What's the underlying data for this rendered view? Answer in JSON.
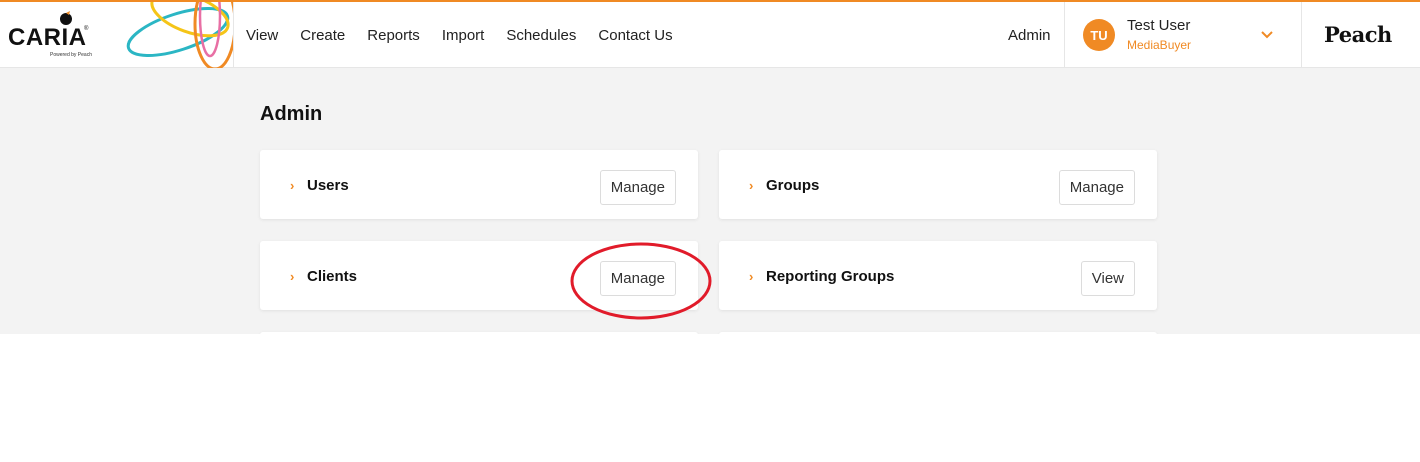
{
  "header": {
    "logo": {
      "name": "CARIA",
      "tagline": "Powered by Peach"
    },
    "nav": [
      "View",
      "Create",
      "Reports",
      "Import",
      "Schedules",
      "Contact Us"
    ],
    "admin_link": "Admin",
    "user": {
      "initials": "TU",
      "name": "Test User",
      "role": "MediaBuyer"
    },
    "brand_right": "Peach"
  },
  "page": {
    "title": "Admin",
    "cards": [
      {
        "label": "Users",
        "button": "Manage"
      },
      {
        "label": "Groups",
        "button": "Manage"
      },
      {
        "label": "Clients",
        "button": "Manage"
      },
      {
        "label": "Reporting Groups",
        "button": "View"
      }
    ]
  },
  "colors": {
    "accent": "#f08a24",
    "background": "#f3f3f3",
    "annotation": "#e11b2a"
  }
}
